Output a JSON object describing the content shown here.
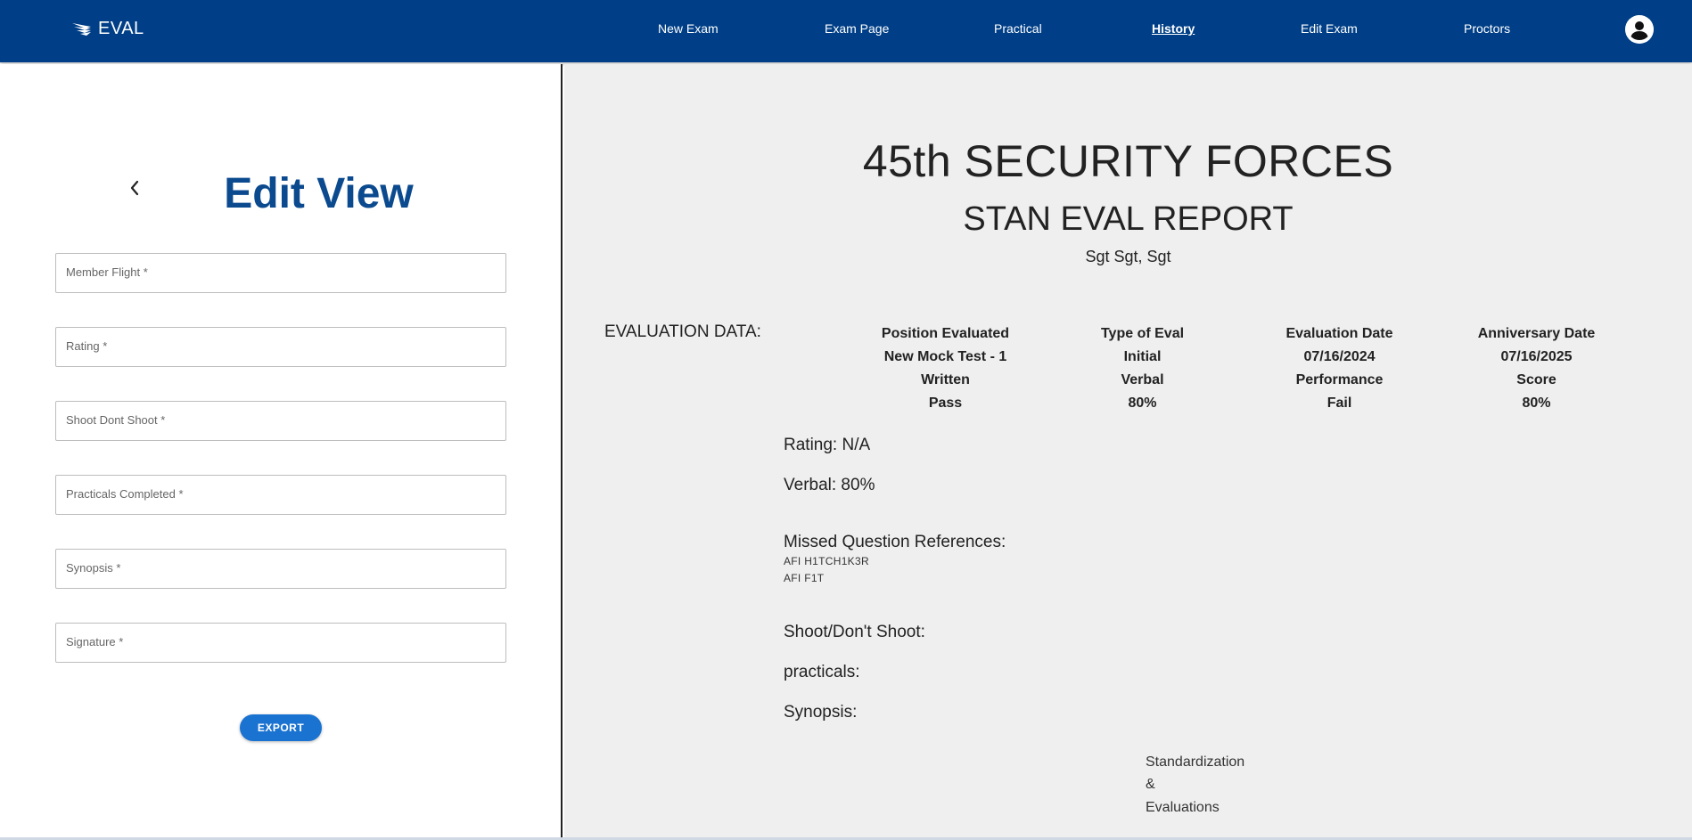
{
  "app": {
    "logo_text": "EVAL"
  },
  "nav": {
    "items": [
      {
        "label": "New Exam"
      },
      {
        "label": "Exam Page"
      },
      {
        "label": "Practical"
      },
      {
        "label": "History",
        "active": true
      },
      {
        "label": "Edit Exam"
      },
      {
        "label": "Proctors"
      }
    ],
    "avatar_icon": "account-circle-icon"
  },
  "left": {
    "back_icon": "chevron-left-icon",
    "title": "Edit View",
    "fields": [
      {
        "label": "Member Flight *",
        "value": ""
      },
      {
        "label": "Rating *",
        "value": ""
      },
      {
        "label": "Shoot Dont Shoot *",
        "value": ""
      },
      {
        "label": "Practicals Completed *",
        "value": ""
      },
      {
        "label": "Synopsis *",
        "value": ""
      },
      {
        "label": "Signature *",
        "value": ""
      }
    ],
    "export_label": "EXPORT"
  },
  "report": {
    "title": "45th SECURITY FORCES",
    "subtitle": "STAN EVAL REPORT",
    "member_name": "Sgt Sgt, Sgt",
    "eval_data_label": "EVALUATION DATA:",
    "grid": [
      [
        "Position Evaluated",
        "Type of Eval",
        "Evaluation Date",
        "Anniversary Date"
      ],
      [
        "New Mock Test - 1",
        "Initial",
        "07/16/2024",
        "07/16/2025"
      ],
      [
        "Written",
        "Verbal",
        "Performance",
        "Score"
      ],
      [
        "Pass",
        "80%",
        "Fail",
        "80%"
      ]
    ],
    "rating_line": "Rating: N/A",
    "verbal_line": "Verbal: 80%",
    "missed_heading": "Missed Question References:",
    "missed_refs": [
      "AFI H1TCH1K3R",
      "AFI F1T"
    ],
    "shoot_line": "Shoot/Don't Shoot:",
    "practicals_line": "practicals:",
    "synopsis_line": "Synopsis:",
    "signature_block": [
      "Standardization",
      "&",
      "Evaluations"
    ]
  },
  "colors": {
    "nav_bg": "#003f87",
    "title_blue": "#0b4a8f",
    "export_bg": "#1a73d1",
    "report_bg": "#efefef"
  }
}
